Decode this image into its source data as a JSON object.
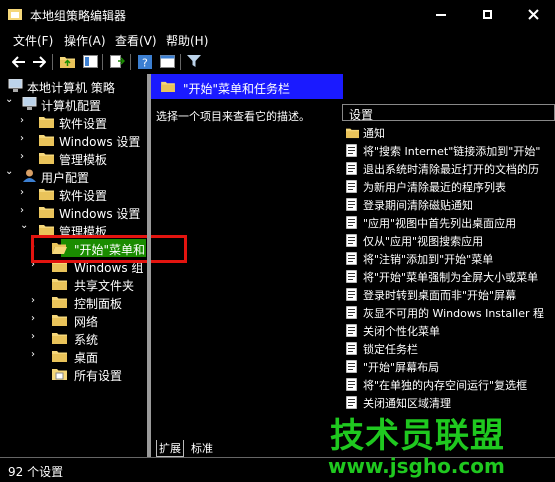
{
  "window": {
    "title": "本地组策略编辑器"
  },
  "menu": [
    "文件(F)",
    "操作(A)",
    "查看(V)",
    "帮助(H)"
  ],
  "toolbar": {
    "icons": [
      "back-arrow-icon",
      "forward-arrow-icon",
      "folder-up-icon",
      "grid-view-icon",
      "export-icon",
      "help-icon",
      "properties-icon",
      "filter-icon"
    ]
  },
  "tree": [
    {
      "label": "本地计算机 策略",
      "depth": 0,
      "twist": "",
      "icon": "computer-icon"
    },
    {
      "label": "计算机配置",
      "depth": 1,
      "twist": "v",
      "icon": "computer-icon"
    },
    {
      "label": "软件设置",
      "depth": 2,
      "twist": ">",
      "icon": "folder-icon"
    },
    {
      "label": "Windows 设置",
      "depth": 2,
      "twist": ">",
      "icon": "folder-icon"
    },
    {
      "label": "管理模板",
      "depth": 2,
      "twist": ">",
      "icon": "folder-icon"
    },
    {
      "label": "用户配置",
      "depth": 1,
      "twist": "v",
      "icon": "user-icon"
    },
    {
      "label": "软件设置",
      "depth": 2,
      "twist": ">",
      "icon": "folder-icon"
    },
    {
      "label": "Windows 设置",
      "depth": 2,
      "twist": ">",
      "icon": "folder-icon"
    },
    {
      "label": "管理模板",
      "depth": 2,
      "twist": "v",
      "icon": "folder-icon"
    },
    {
      "label": "\"开始\"菜单和",
      "depth": 3,
      "twist": ">",
      "icon": "folder-open-icon",
      "selected": true
    },
    {
      "label": "Windows 组",
      "depth": 3,
      "twist": ">",
      "icon": "folder-icon"
    },
    {
      "label": "共享文件夹",
      "depth": 3,
      "twist": "",
      "icon": "folder-icon"
    },
    {
      "label": "控制面板",
      "depth": 3,
      "twist": ">",
      "icon": "folder-icon"
    },
    {
      "label": "网络",
      "depth": 3,
      "twist": ">",
      "icon": "folder-icon"
    },
    {
      "label": "系统",
      "depth": 3,
      "twist": ">",
      "icon": "folder-icon"
    },
    {
      "label": "桌面",
      "depth": 3,
      "twist": ">",
      "icon": "folder-icon"
    },
    {
      "label": "所有设置",
      "depth": 3,
      "twist": "",
      "icon": "settings-folder-icon"
    }
  ],
  "right": {
    "header": "\"开始\"菜单和任务栏",
    "description": "选择一个项目来查看它的描述。",
    "column": "设置",
    "items": [
      {
        "label": "通知",
        "icon": "folder-icon"
      },
      {
        "label": "将\"搜索 Internet\"链接添加到\"开始\"",
        "icon": "policy-icon"
      },
      {
        "label": "退出系统时清除最近打开的文档的历",
        "icon": "policy-icon"
      },
      {
        "label": "为新用户清除最近的程序列表",
        "icon": "policy-icon"
      },
      {
        "label": "登录期间清除磁贴通知",
        "icon": "policy-icon"
      },
      {
        "label": "\"应用\"视图中首先列出桌面应用",
        "icon": "policy-icon"
      },
      {
        "label": "仅从\"应用\"视图搜索应用",
        "icon": "policy-icon"
      },
      {
        "label": "将\"注销\"添加到\"开始\"菜单",
        "icon": "policy-icon"
      },
      {
        "label": "将\"开始\"菜单强制为全屏大小或菜单",
        "icon": "policy-icon"
      },
      {
        "label": "登录时转到桌面而非\"开始\"屏幕",
        "icon": "policy-icon"
      },
      {
        "label": "灰显不可用的 Windows Installer 程",
        "icon": "policy-icon"
      },
      {
        "label": "关闭个性化菜单",
        "icon": "policy-icon"
      },
      {
        "label": "锁定任务栏",
        "icon": "policy-icon"
      },
      {
        "label": "\"开始\"屏幕布局",
        "icon": "policy-icon"
      },
      {
        "label": "将\"在单独的内存空间运行\"复选框",
        "icon": "policy-icon"
      },
      {
        "label": "关闭通知区域清理",
        "icon": "policy-icon"
      }
    ],
    "tabs": [
      "扩展",
      "标准"
    ]
  },
  "status": "92 个设置",
  "watermark": {
    "main": "技术员联盟",
    "sub": "www.jsgho.com"
  },
  "colors": {
    "background": "#000000",
    "selection": "#1a8c00",
    "header": "#1a1aff",
    "folder": "#f5d77a",
    "highlight": "#e3140f",
    "watermark": "#1fc81f"
  }
}
